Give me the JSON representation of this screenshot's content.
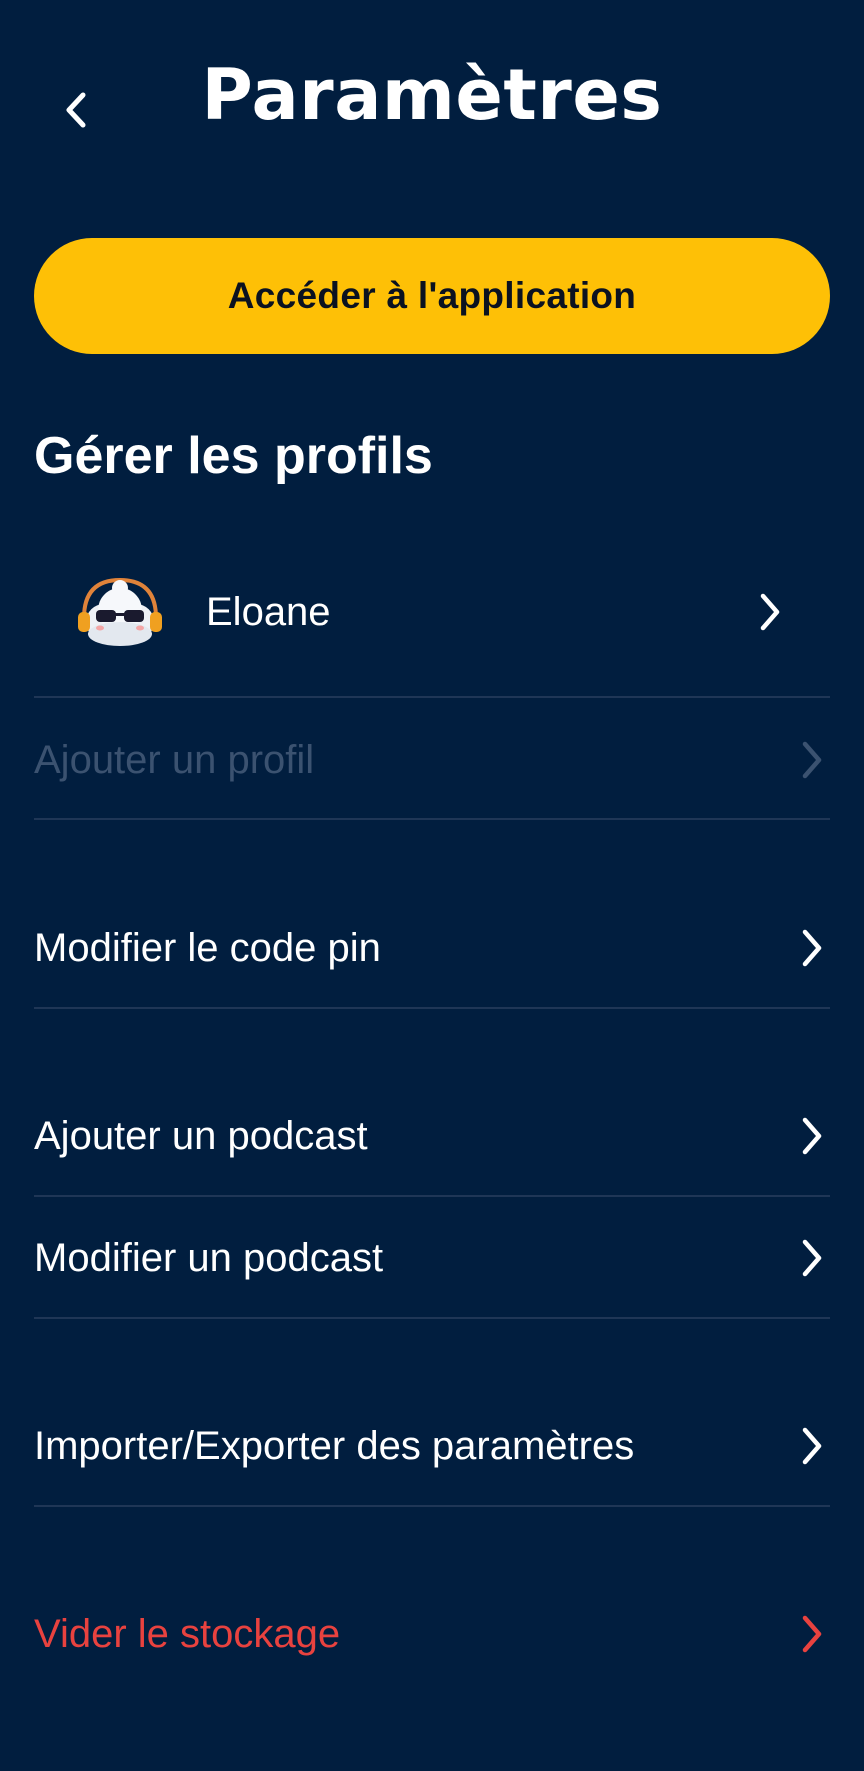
{
  "header": {
    "title": "Paramètres",
    "back_icon": "chevron-left-icon"
  },
  "primary_button": {
    "label": "Accéder à l'application",
    "color": "#fec006"
  },
  "profiles_section": {
    "title": "Gérer les profils",
    "profiles": [
      {
        "name": "Eloane",
        "avatar": "cloud-dj-avatar"
      }
    ],
    "add_profile_label": "Ajouter un profil"
  },
  "settings": {
    "pin_label": "Modifier le code pin",
    "add_podcast_label": "Ajouter un podcast",
    "edit_podcast_label": "Modifier un podcast",
    "import_export_label": "Importer/Exporter des paramètres",
    "clear_storage_label": "Vider le stockage"
  },
  "colors": {
    "background": "#011e3f",
    "accent": "#fec006",
    "danger": "#e8423f",
    "disabled": "#3b5270",
    "divider": "#1f3656"
  }
}
